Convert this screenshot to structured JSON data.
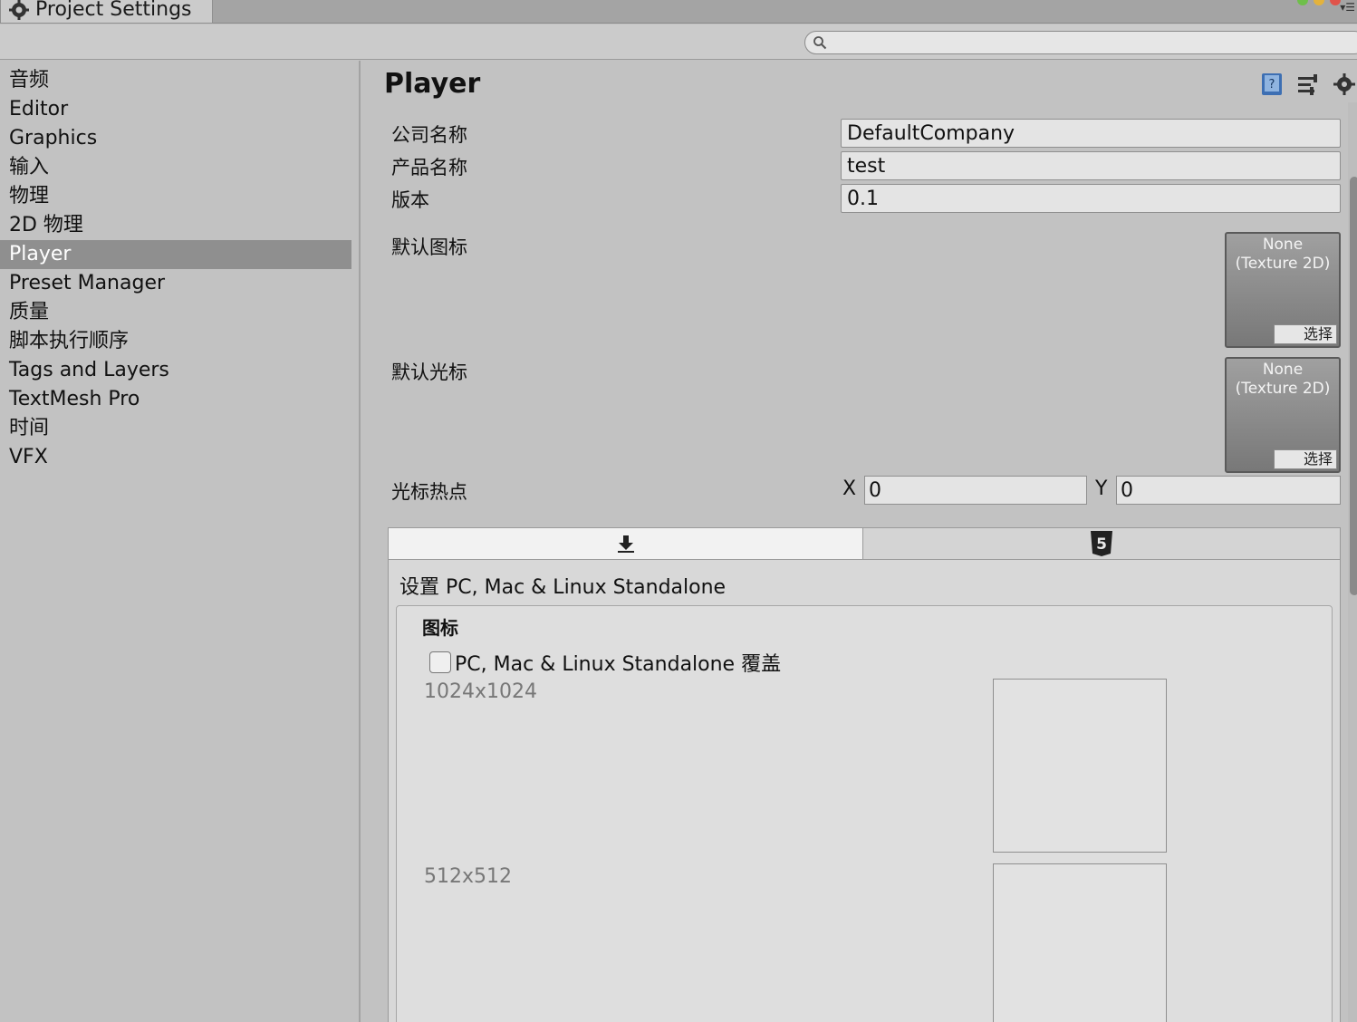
{
  "window": {
    "tab_title": "Project Settings",
    "search_placeholder": ""
  },
  "sidebar": {
    "selected": "Player",
    "items": [
      "音频",
      "Editor",
      "Graphics",
      "输入",
      "物理",
      "2D 物理",
      "Player",
      "Preset Manager",
      "质量",
      "脚本执行顺序",
      "Tags and Layers",
      "TextMesh Pro",
      "时间",
      "VFX"
    ]
  },
  "player": {
    "title": "Player",
    "company_label": "公司名称",
    "company_value": "DefaultCompany",
    "product_label": "产品名称",
    "product_value": "test",
    "version_label": "版本",
    "version_value": "0.1",
    "default_icon_label": "默认图标",
    "default_icon_value_line1": "None",
    "default_icon_value_line2": "(Texture 2D)",
    "default_cursor_label": "默认光标",
    "default_cursor_value_line1": "None",
    "default_cursor_value_line2": "(Texture 2D)",
    "select_label": "选择",
    "hotspot_label": "光标热点",
    "hotspot_x_label": "X",
    "hotspot_x": "0",
    "hotspot_y_label": "Y",
    "hotspot_y": "0"
  },
  "platform": {
    "tabs": [
      {
        "icon": "download-arrow-icon",
        "active": true
      },
      {
        "icon": "html5-icon",
        "active": false
      }
    ],
    "settings_title": "设置 PC, Mac & Linux Standalone",
    "icon_section_title": "图标",
    "override_label": "PC, Mac & Linux Standalone 覆盖",
    "override_checked": false,
    "sizes": [
      "1024x1024",
      "512x512"
    ]
  }
}
